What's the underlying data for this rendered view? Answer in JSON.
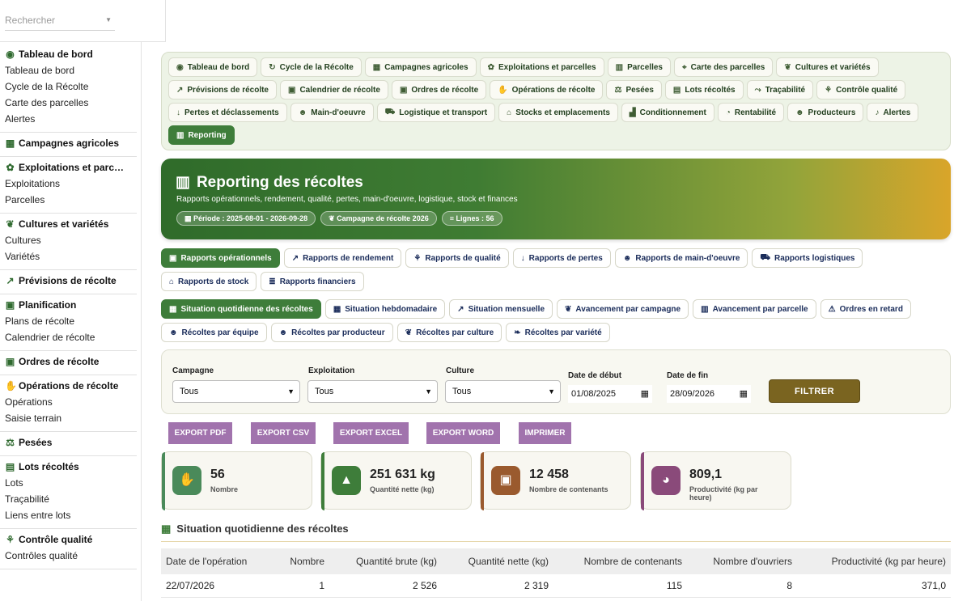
{
  "sidebar": {
    "search_placeholder": "Rechercher",
    "sections": [
      {
        "title": "Tableau de bord",
        "icon": "gauge-icon",
        "glyph": "◉",
        "items": [
          "Tableau de bord",
          "Cycle de la Récolte",
          "Carte des parcelles",
          "Alertes"
        ]
      },
      {
        "title": "Campagnes agricoles",
        "icon": "calendar-icon",
        "glyph": "▦",
        "items": []
      },
      {
        "title": "Exploitations et parc…",
        "icon": "tractor-icon",
        "glyph": "✿",
        "items": [
          "Exploitations",
          "Parcelles"
        ]
      },
      {
        "title": "Cultures et variétés",
        "icon": "seedling-icon",
        "glyph": "❦",
        "items": [
          "Cultures",
          "Variétés"
        ]
      },
      {
        "title": "Prévisions de récolte",
        "icon": "chart-line-icon",
        "glyph": "↗",
        "items": []
      },
      {
        "title": "Planification",
        "icon": "calendar-check-icon",
        "glyph": "▣",
        "items": [
          "Plans de récolte",
          "Calendrier de récolte"
        ]
      },
      {
        "title": "Ordres de récolte",
        "icon": "clipboard-check-icon",
        "glyph": "▣",
        "items": []
      },
      {
        "title": "Opérations de récolte",
        "icon": "hand-icon",
        "glyph": "✋",
        "items": [
          "Opérations",
          "Saisie terrain"
        ]
      },
      {
        "title": "Pesées",
        "icon": "scale-icon",
        "glyph": "⚖",
        "items": []
      },
      {
        "title": "Lots récoltés",
        "icon": "boxes-icon",
        "glyph": "▤",
        "items": [
          "Lots",
          "Traçabilité",
          "Liens entre lots"
        ]
      },
      {
        "title": "Contrôle qualité",
        "icon": "quality-icon",
        "glyph": "⚘",
        "items": [
          "Contrôles qualité"
        ]
      }
    ]
  },
  "nav_tabs": [
    {
      "label": "Tableau de bord",
      "icon": "gauge-icon",
      "glyph": "◉"
    },
    {
      "label": "Cycle de la Récolte",
      "icon": "refresh-icon",
      "glyph": "↻"
    },
    {
      "label": "Campagnes agricoles",
      "icon": "calendar-icon",
      "glyph": "▦"
    },
    {
      "label": "Exploitations et parcelles",
      "icon": "tractor-icon",
      "glyph": "✿"
    },
    {
      "label": "Parcelles",
      "icon": "map-icon",
      "glyph": "▥"
    },
    {
      "label": "Carte des parcelles",
      "icon": "map-marked-icon",
      "glyph": "⌖"
    },
    {
      "label": "Cultures et variétés",
      "icon": "seedling-icon",
      "glyph": "❦"
    },
    {
      "label": "Prévisions de récolte",
      "icon": "chart-line-icon",
      "glyph": "↗"
    },
    {
      "label": "Calendrier de récolte",
      "icon": "calendar-check-icon",
      "glyph": "▣"
    },
    {
      "label": "Ordres de récolte",
      "icon": "clipboard-check-icon",
      "glyph": "▣"
    },
    {
      "label": "Opérations de récolte",
      "icon": "hand-icon",
      "glyph": "✋"
    },
    {
      "label": "Pesées",
      "icon": "scale-icon",
      "glyph": "⚖"
    },
    {
      "label": "Lots récoltés",
      "icon": "boxes-icon",
      "glyph": "▤"
    },
    {
      "label": "Traçabilité",
      "icon": "route-icon",
      "glyph": "⤳"
    },
    {
      "label": "Contrôle qualité",
      "icon": "quality-icon",
      "glyph": "⚘"
    },
    {
      "label": "Pertes et déclassements",
      "icon": "arrow-down-icon",
      "glyph": "↓"
    },
    {
      "label": "Main-d'oeuvre",
      "icon": "users-icon",
      "glyph": "☻"
    },
    {
      "label": "Logistique et transport",
      "icon": "truck-icon",
      "glyph": "⛟"
    },
    {
      "label": "Stocks et emplacements",
      "icon": "warehouse-icon",
      "glyph": "⌂"
    },
    {
      "label": "Conditionnement",
      "icon": "pallet-icon",
      "glyph": "▟"
    },
    {
      "label": "Rentabilité",
      "icon": "pie-chart-icon",
      "glyph": "◔"
    },
    {
      "label": "Producteurs",
      "icon": "users-icon",
      "glyph": "☻"
    },
    {
      "label": "Alertes",
      "icon": "bell-icon",
      "glyph": "♪"
    },
    {
      "label": "Reporting",
      "icon": "chart-bar-icon",
      "glyph": "▥",
      "active": true
    }
  ],
  "hero": {
    "title": "Reporting des récoltes",
    "subtitle": "Rapports opérationnels, rendement, qualité, pertes, main-d'oeuvre, logistique, stock et finances",
    "chips": [
      "Période : 2025-08-01 - 2026-09-28",
      "Campagne de récolte 2026",
      "Lignes : 56"
    ]
  },
  "report_tabs": [
    {
      "label": "Rapports opérationnels",
      "icon": "clipboard-icon",
      "glyph": "▣",
      "active": true
    },
    {
      "label": "Rapports de rendement",
      "icon": "chart-line-icon",
      "glyph": "↗"
    },
    {
      "label": "Rapports de qualité",
      "icon": "quality-icon",
      "glyph": "⚘"
    },
    {
      "label": "Rapports de pertes",
      "icon": "arrow-down-icon",
      "glyph": "↓"
    },
    {
      "label": "Rapports de main-d'oeuvre",
      "icon": "users-icon",
      "glyph": "☻"
    },
    {
      "label": "Rapports logistiques",
      "icon": "truck-icon",
      "glyph": "⛟"
    },
    {
      "label": "Rapports de stock",
      "icon": "warehouse-icon",
      "glyph": "⌂"
    },
    {
      "label": "Rapports financiers",
      "icon": "money-icon",
      "glyph": "≣"
    }
  ],
  "sub_tabs": [
    {
      "label": "Situation quotidienne des récoltes",
      "icon": "calendar-day-icon",
      "glyph": "▦",
      "active": true
    },
    {
      "label": "Situation hebdomadaire",
      "icon": "calendar-week-icon",
      "glyph": "▦"
    },
    {
      "label": "Situation mensuelle",
      "icon": "chart-area-icon",
      "glyph": "↗"
    },
    {
      "label": "Avancement par campagne",
      "icon": "seedling-icon",
      "glyph": "❦"
    },
    {
      "label": "Avancement par parcelle",
      "icon": "map-icon",
      "glyph": "▥"
    },
    {
      "label": "Ordres en retard",
      "icon": "warning-icon",
      "glyph": "⚠"
    },
    {
      "label": "Récoltes par équipe",
      "icon": "users-icon",
      "glyph": "☻"
    },
    {
      "label": "Récoltes par producteur",
      "icon": "users-icon",
      "glyph": "☻"
    },
    {
      "label": "Récoltes par culture",
      "icon": "seedling-icon",
      "glyph": "❦"
    },
    {
      "label": "Récoltes par variété",
      "icon": "leaf-icon",
      "glyph": "❧"
    }
  ],
  "filters": {
    "campagne_label": "Campagne",
    "campagne_value": "Tous",
    "exploitation_label": "Exploitation",
    "exploitation_value": "Tous",
    "culture_label": "Culture",
    "culture_value": "Tous",
    "date_debut_label": "Date de début",
    "date_debut_value": "01/08/2025",
    "date_fin_label": "Date de fin",
    "date_fin_value": "28/09/2026",
    "submit_label": "FILTRER"
  },
  "exports": [
    "EXPORT PDF",
    "EXPORT CSV",
    "EXPORT EXCEL",
    "EXPORT WORD",
    "IMPRIMER"
  ],
  "kpis": [
    {
      "value": "56",
      "label": "Nombre",
      "icon": "hand-icon",
      "glyph": "✋",
      "color": "#4a8a5a"
    },
    {
      "value": "251 631 kg",
      "label": "Quantité nette (kg)",
      "icon": "weight-icon",
      "glyph": "▲",
      "color": "#3e7d3a"
    },
    {
      "value": "12 458",
      "label": "Nombre de contenants",
      "icon": "box-icon",
      "glyph": "▣",
      "color": "#9a5a2e"
    },
    {
      "value": "809,1",
      "label": "Productivité (kg par heure)",
      "icon": "speedometer-icon",
      "glyph": "◕",
      "color": "#8a4a7a"
    }
  ],
  "section_title": "Situation quotidienne des récoltes",
  "table": {
    "columns": [
      "Date de l'opération",
      "Nombre",
      "Quantité brute (kg)",
      "Quantité nette (kg)",
      "Nombre de contenants",
      "Nombre d'ouvriers",
      "Productivité (kg par heure)"
    ],
    "rows": [
      [
        "22/07/2026",
        "1",
        "2 526",
        "2 319",
        "115",
        "8",
        "371,0"
      ]
    ]
  }
}
